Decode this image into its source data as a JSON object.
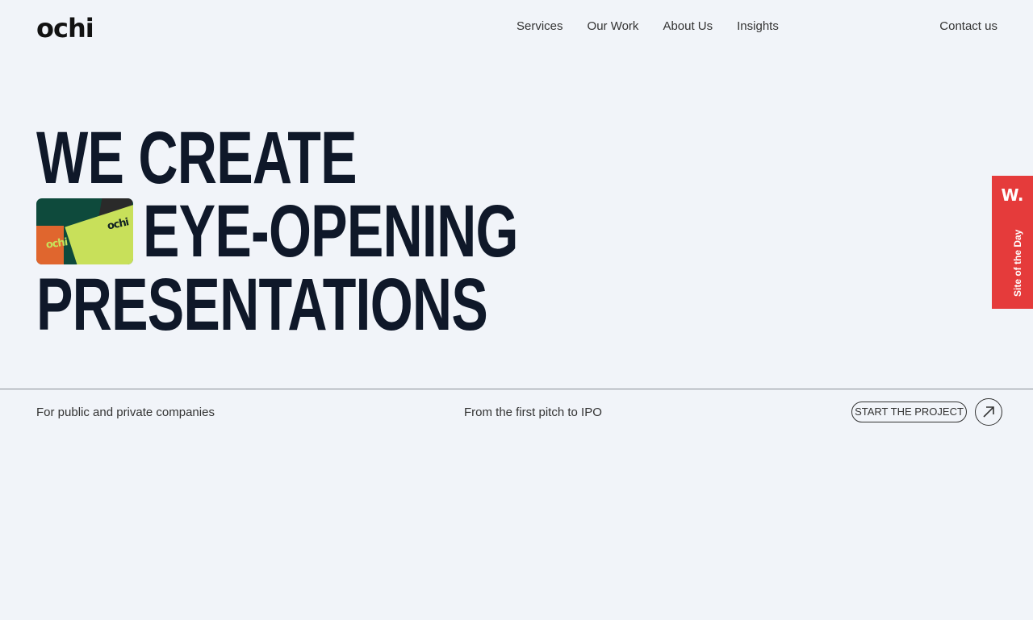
{
  "header": {
    "logo": "ochi",
    "nav": [
      "Services",
      "Our Work",
      "About Us",
      "Insights"
    ],
    "contact": "Contact us"
  },
  "hero": {
    "line1": "WE CREATE",
    "line2": "EYE-OPENING",
    "line3": "PRESENTATIONS",
    "thumb_brand": "ochi"
  },
  "footer_row": {
    "left_text": "For public and private companies",
    "mid_text": "From the first pitch to IPO",
    "cta_label": "START THE PROJECT"
  },
  "badge": {
    "mark": "W.",
    "label": "Site of the Day"
  },
  "colors": {
    "background": "#f1f4f9",
    "hero_text": "#0f1829",
    "badge": "#e53b3b"
  }
}
